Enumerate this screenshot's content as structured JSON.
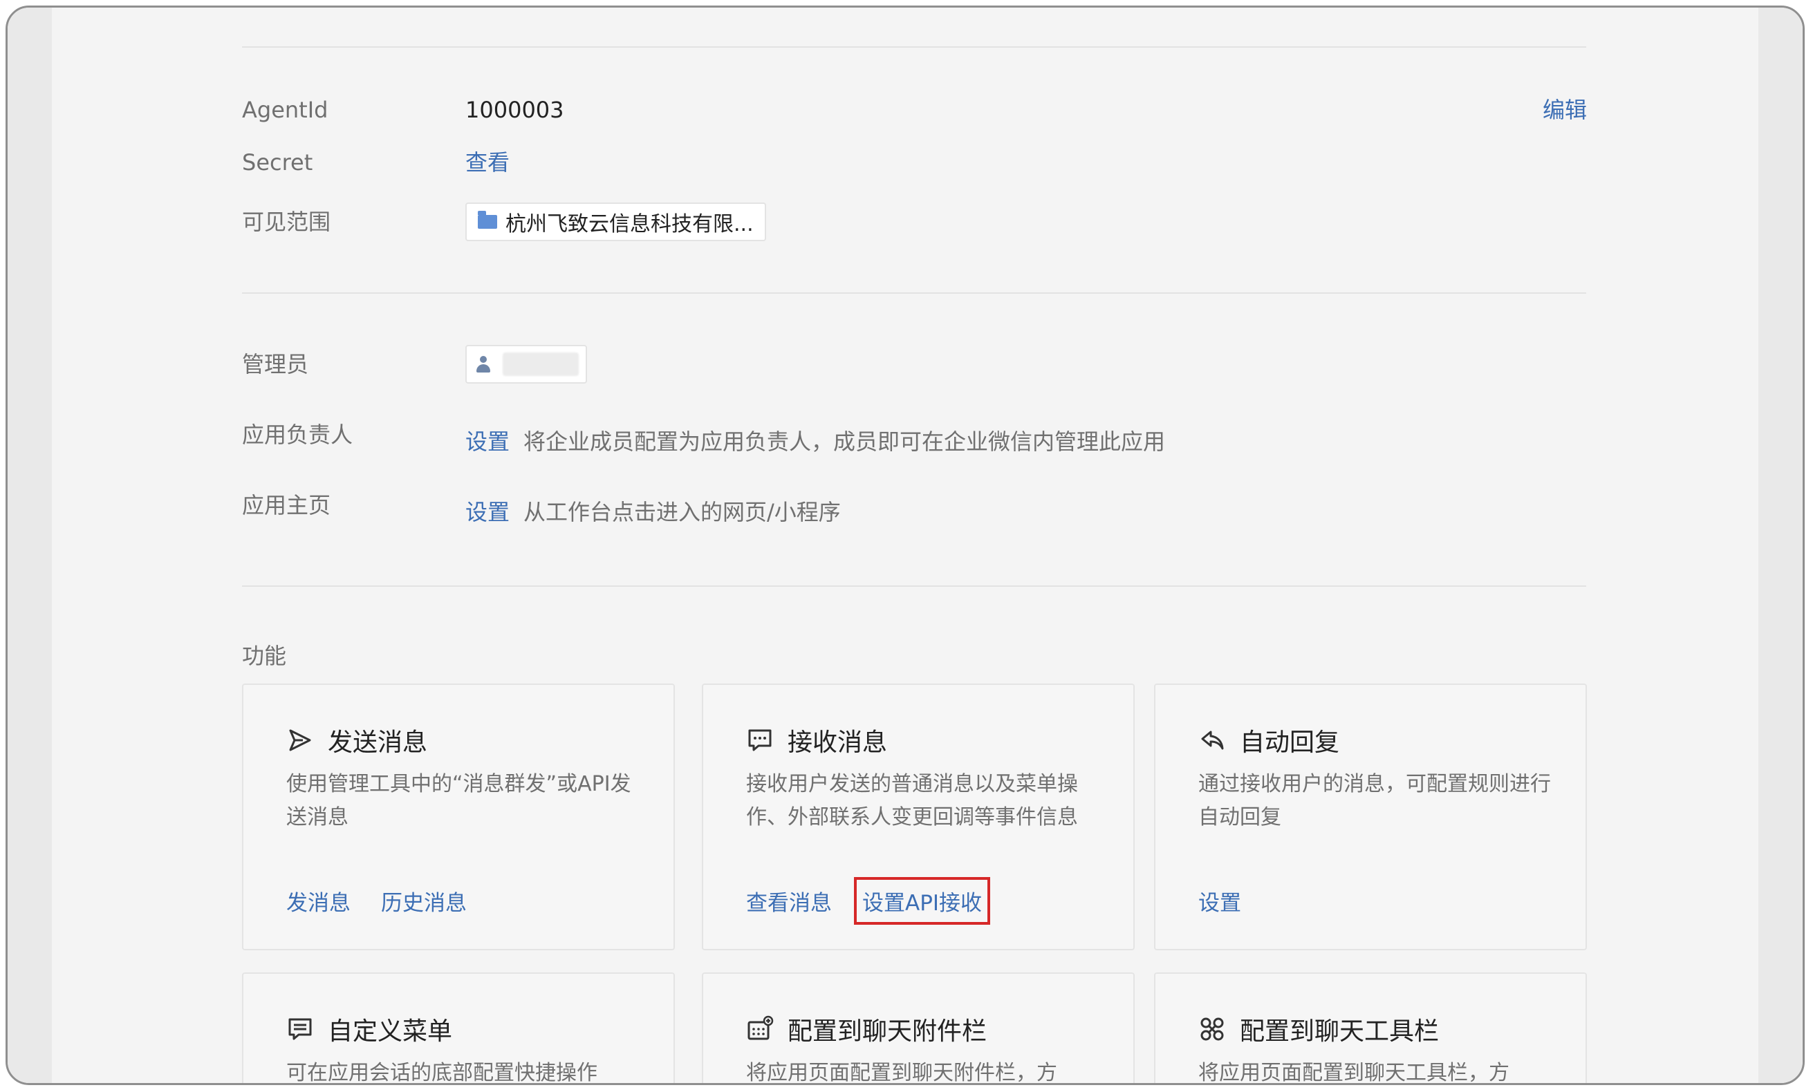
{
  "basic_info": {
    "agentid_label": "AgentId",
    "agentid_value": "1000003",
    "edit_link": "编辑",
    "secret_label": "Secret",
    "secret_link": "查看",
    "visible_label": "可见范围",
    "visible_value": "杭州飞致云信息科技有限..."
  },
  "management": {
    "admin_label": "管理员",
    "owner_label": "应用负责人",
    "owner_link": "设置",
    "owner_hint": "将企业成员配置为应用负责人，成员即可在企业微信内管理此应用",
    "home_label": "应用主页",
    "home_link": "设置",
    "home_hint": "从工作台点击进入的网页/小程序"
  },
  "features": {
    "section_label": "功能",
    "cards": [
      {
        "title": "发送消息",
        "desc": "使用管理工具中的“消息群发”或API发送消息",
        "links": [
          "发消息",
          "历史消息"
        ]
      },
      {
        "title": "接收消息",
        "desc": "接收用户发送的普通消息以及菜单操作、外部联系人变更回调等事件信息",
        "links": [
          "查看消息",
          "设置API接收"
        ]
      },
      {
        "title": "自动回复",
        "desc": "通过接收用户的消息，可配置规则进行自动回复",
        "links": [
          "设置"
        ]
      },
      {
        "title": "自定义菜单",
        "desc": "可在应用会话的底部配置快捷操作"
      },
      {
        "title": "配置到聊天附件栏",
        "desc": "将应用页面配置到聊天附件栏，方"
      },
      {
        "title": "配置到聊天工具栏",
        "desc": "将应用页面配置到聊天工具栏，方"
      }
    ]
  },
  "colors": {
    "link": "#3c6eb4",
    "highlight": "#d62828"
  }
}
